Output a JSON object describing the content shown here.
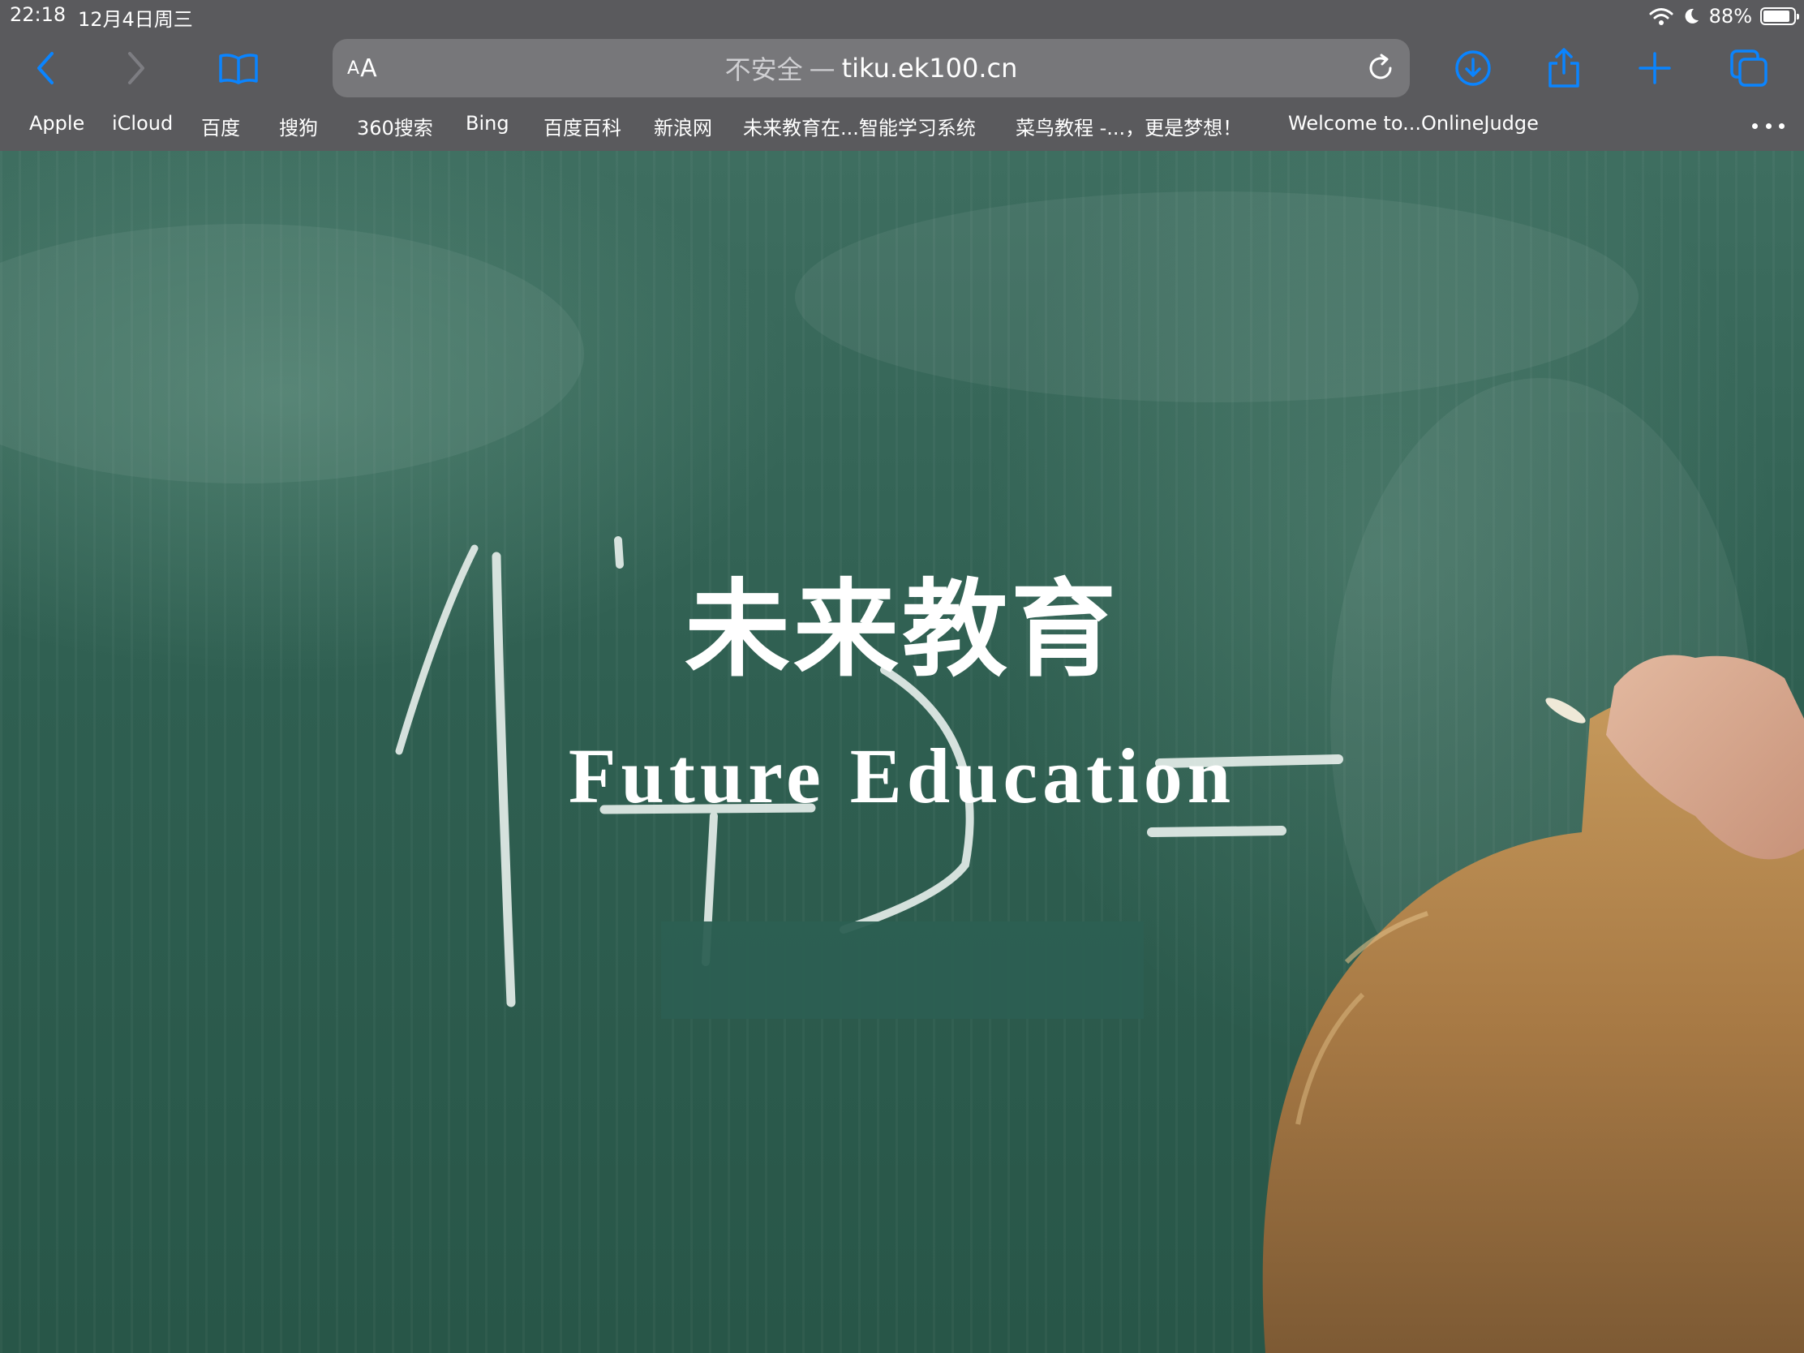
{
  "status_bar": {
    "time": "22:18",
    "date": "12月4日周三",
    "battery_percent": "88%",
    "battery_level": 0.88
  },
  "toolbar": {
    "back_icon": "chevron-left-icon",
    "forward_icon": "chevron-right-icon",
    "bookmarks_icon": "book-icon",
    "reader_label_small": "A",
    "reader_label_large": "A",
    "address": {
      "security": "不安全",
      "separator": "—",
      "domain": "tiku.ek100.cn"
    },
    "reload_icon": "reload-icon",
    "download_icon": "download-icon",
    "share_icon": "share-icon",
    "new_tab_icon": "plus-icon",
    "tabs_icon": "tabs-icon",
    "accent_color": "#0a84ff"
  },
  "bookmarks": [
    "Apple",
    "iCloud",
    "百度",
    "搜狗",
    "360搜索",
    "Bing",
    "百度百科",
    "新浪网",
    "未来教育在...智能学习系统",
    "菜鸟教程 -...，更是梦想！",
    "Welcome to...OnlineJudge"
  ],
  "page": {
    "title": "未来教育",
    "subtitle": "Future Education",
    "board_color": "#2f5f51"
  }
}
